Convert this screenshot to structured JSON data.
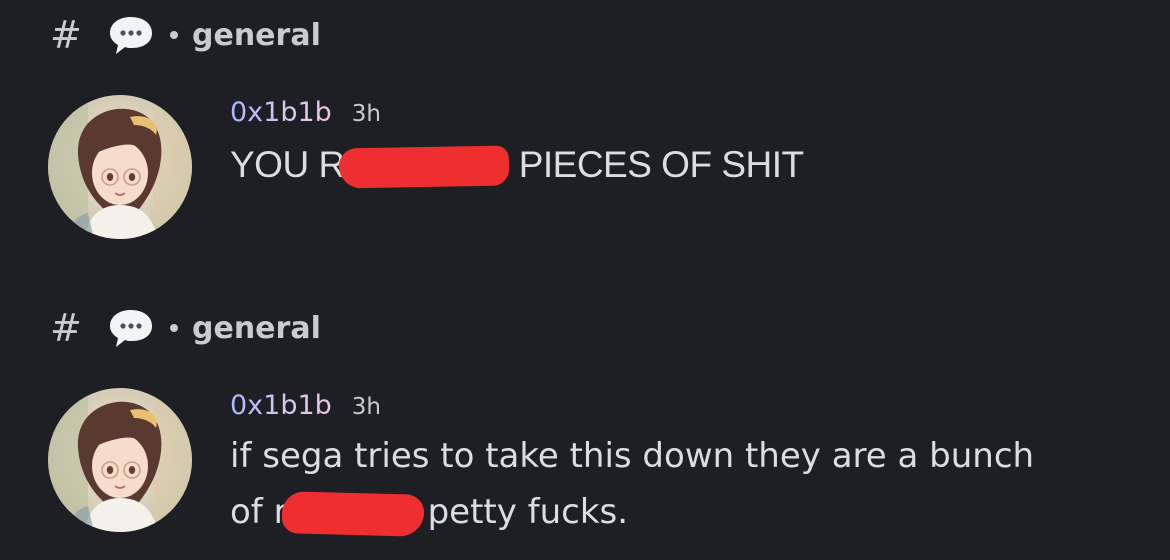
{
  "feed": [
    {
      "channel": {
        "hash_symbol": "#",
        "icon": "speech-bubble-icon",
        "name": "general"
      },
      "message": {
        "avatar": "anime-girl-avatar",
        "username": "0x1b1b",
        "timestamp": "3h",
        "text_before": "YOU R",
        "text_after": "PIECES OF SHIT",
        "redaction_color": "#ef2f2f"
      }
    },
    {
      "channel": {
        "hash_symbol": "#",
        "icon": "speech-bubble-icon",
        "name": "general"
      },
      "message": {
        "avatar": "anime-girl-avatar",
        "username": "0x1b1b",
        "timestamp": "3h",
        "line1": "if sega tries to take this down they are a bunch",
        "line2_before": "of r",
        "line2_after": "petty fucks.",
        "redaction_color": "#ef2f2f"
      }
    }
  ],
  "colors": {
    "background": "#1e1f24",
    "text": "#dbdee1",
    "muted": "#c9cbd0",
    "username_gradient_start": "#a9b6ff",
    "username_gradient_end": "#f0c4e4"
  }
}
